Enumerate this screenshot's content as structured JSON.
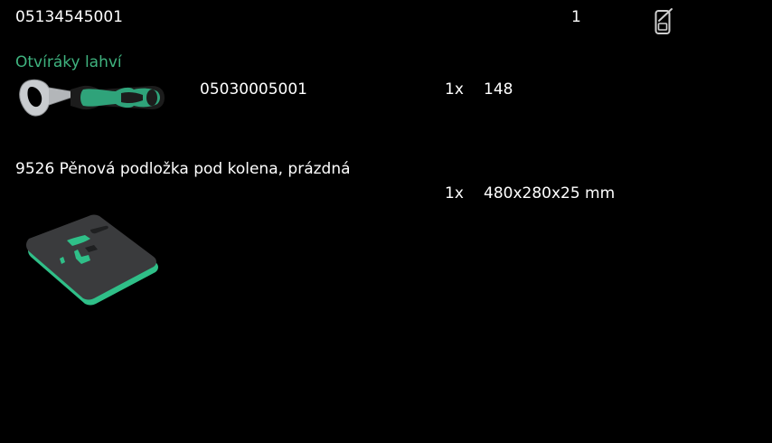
{
  "header": {
    "article_number": "05134545001",
    "quantity": "1",
    "icon": "mobile-phone-icon"
  },
  "category": {
    "title": "Otvíráky lahví"
  },
  "items": [
    {
      "image": "bottle-opener-image",
      "article_number": "05030005001",
      "quantity": "1x",
      "size": "148"
    },
    {
      "name": "9526 Pěnová podložka pod kolena, prázdná",
      "quantity": "1x",
      "size": "480x280x25 mm",
      "image": "knee-pad-image"
    }
  ],
  "colors": {
    "background": "#000000",
    "text": "#ffffff",
    "accent": "#3fb37f"
  }
}
